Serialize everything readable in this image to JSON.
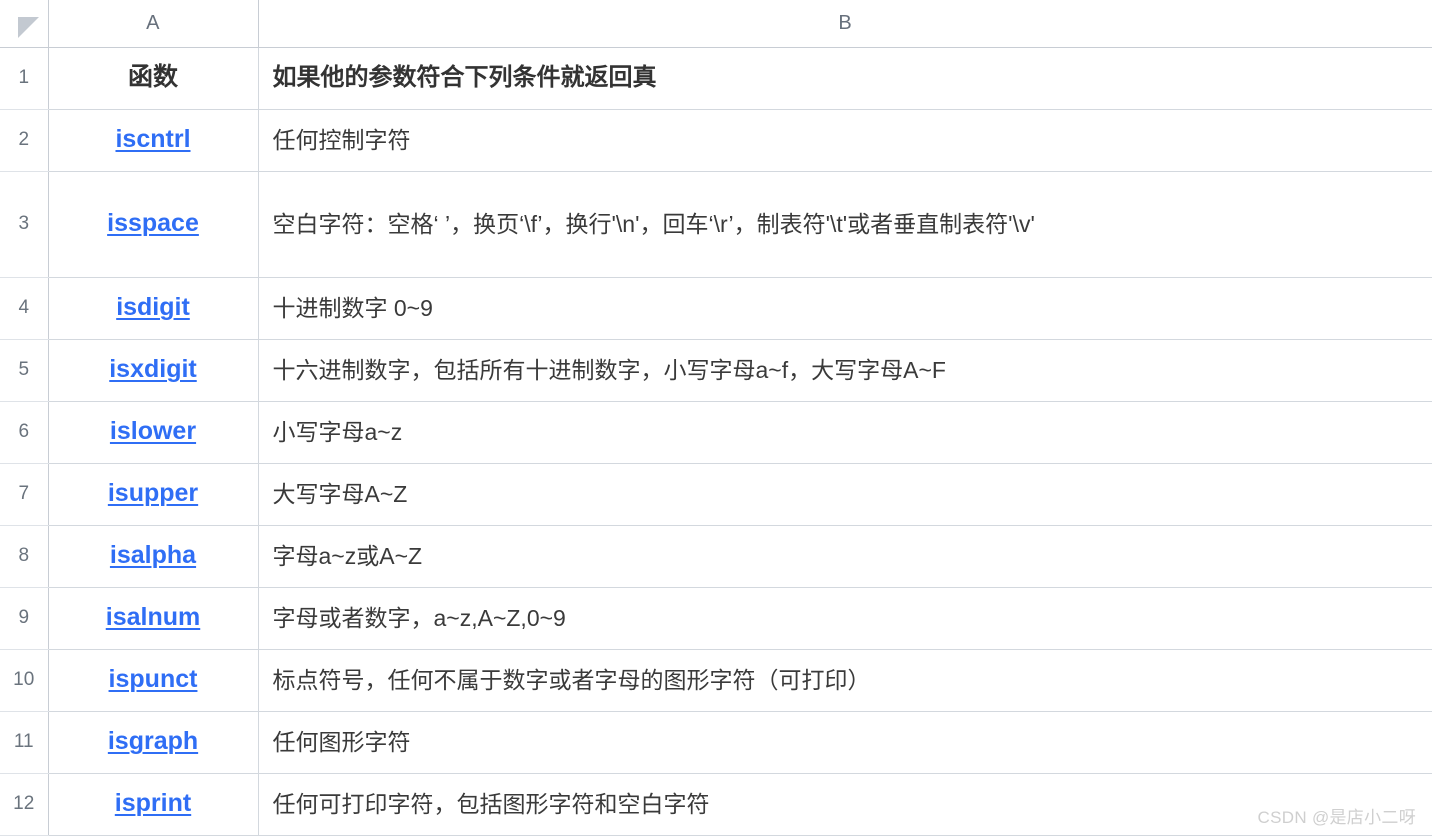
{
  "spreadsheet": {
    "select_all_icon": "select-all-triangle-icon",
    "column_headers": [
      "A",
      "B"
    ],
    "row_numbers": [
      "1",
      "2",
      "3",
      "4",
      "5",
      "6",
      "7",
      "8",
      "9",
      "10",
      "11",
      "12"
    ],
    "link_color": "#2f6ef5",
    "text_color": "#3a3a3a",
    "grid_line_color": "#d3d8de",
    "header_line_color": "#c8cdd4",
    "table_header": {
      "function": "函数",
      "condition": "如果他的参数符合下列条件就返回真"
    },
    "rows": [
      {
        "row": "2",
        "function": "iscntrl",
        "description": "任何控制字符"
      },
      {
        "row": "3",
        "function": "isspace",
        "description": "空白字符：空格‘ ’，换页‘\\f’，换行'\\n'，回车‘\\r’，制表符'\\t'或者垂直制表符'\\v'"
      },
      {
        "row": "4",
        "function": "isdigit",
        "description": "十进制数字 0~9"
      },
      {
        "row": "5",
        "function": "isxdigit",
        "description": "十六进制数字，包括所有十进制数字，小写字母a~f，大写字母A~F"
      },
      {
        "row": "6",
        "function": "islower",
        "description": "小写字母a~z"
      },
      {
        "row": "7",
        "function": "isupper",
        "description": "大写字母A~Z"
      },
      {
        "row": "8",
        "function": "isalpha",
        "description": "字母a~z或A~Z"
      },
      {
        "row": "9",
        "function": "isalnum",
        "description": "字母或者数字，a~z,A~Z,0~9"
      },
      {
        "row": "10",
        "function": "ispunct",
        "description": "标点符号，任何不属于数字或者字母的图形字符（可打印）"
      },
      {
        "row": "11",
        "function": "isgraph",
        "description": "任何图形字符"
      },
      {
        "row": "12",
        "function": "isprint",
        "description": "任何可打印字符，包括图形字符和空白字符"
      }
    ]
  },
  "watermark": "CSDN @是店小二呀"
}
